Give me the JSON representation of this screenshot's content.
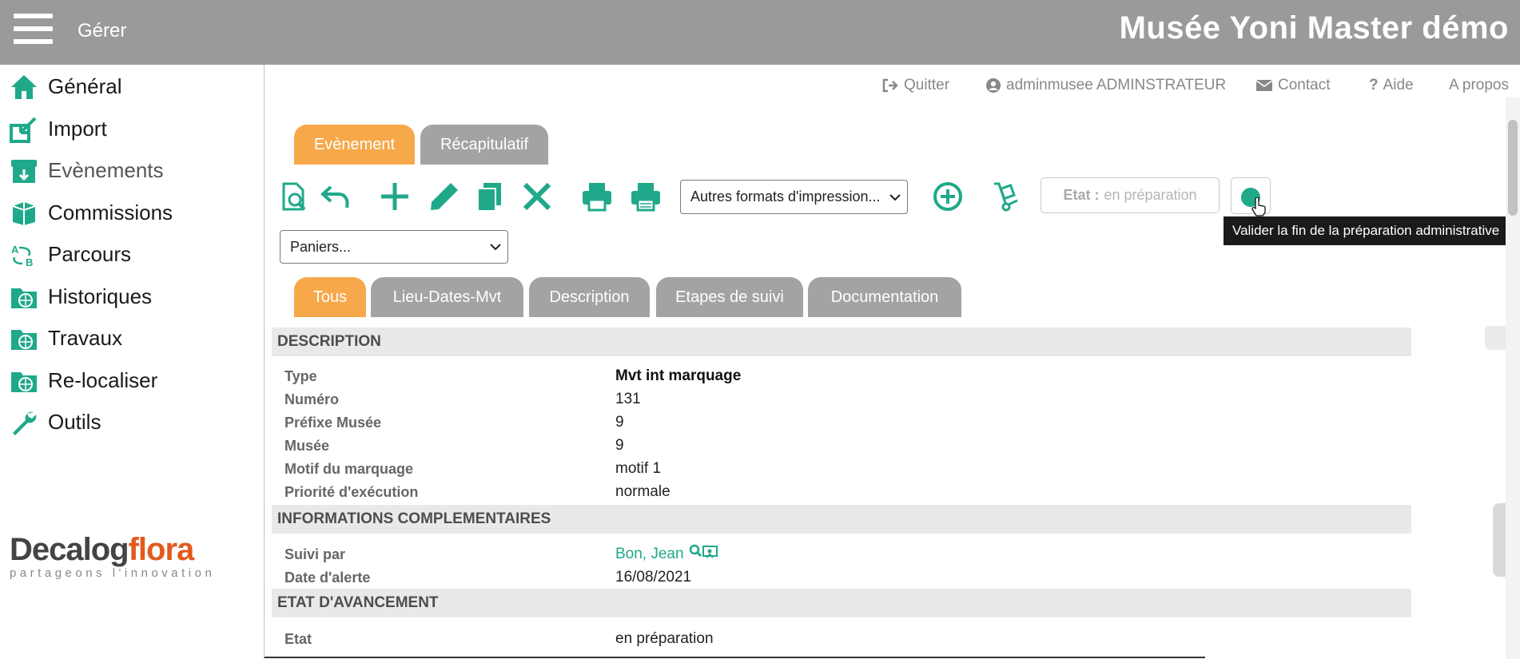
{
  "header": {
    "menu_label": "Gérer",
    "app_title": "Musée Yoni Master démo"
  },
  "sidebar": {
    "items": [
      {
        "label": "Général",
        "icon": "home-icon"
      },
      {
        "label": "Import",
        "icon": "import-icon"
      },
      {
        "label": "Evènements",
        "icon": "events-box-icon"
      },
      {
        "label": "Commissions",
        "icon": "commissions-icon"
      },
      {
        "label": "Parcours",
        "icon": "parcours-icon"
      },
      {
        "label": "Historiques",
        "icon": "folder-globe-icon"
      },
      {
        "label": "Travaux",
        "icon": "folder-globe-icon"
      },
      {
        "label": "Re-localiser",
        "icon": "folder-globe-icon"
      },
      {
        "label": "Outils",
        "icon": "wrench-icon"
      }
    ],
    "logo": {
      "part1": "Decalog",
      "part2": "flora",
      "tagline": "partageons l'innovation"
    }
  },
  "usermenu": {
    "quit": "Quitter",
    "user": "adminmusee ADMINSTRATEUR",
    "contact": "Contact",
    "help": "Aide",
    "about": "A propos"
  },
  "top_tabs": [
    "Evènement",
    "Récapitulatif"
  ],
  "toolbar": {
    "print_formats": "Autres formats d'impression...",
    "baskets": "Paniers...",
    "etat_label": "Etat :",
    "etat_value": "en préparation",
    "tooltip": "Valider la fin de la préparation administrative"
  },
  "sub_tabs": [
    "Tous",
    "Lieu-Dates-Mvt",
    "Description",
    "Etapes de suivi",
    "Documentation"
  ],
  "sections": {
    "description": {
      "title": "DESCRIPTION",
      "rows": [
        {
          "label": "Type",
          "value": "Mvt int marquage"
        },
        {
          "label": "Numéro",
          "value": "131"
        },
        {
          "label": "Préfixe Musée",
          "value": "9"
        },
        {
          "label": "Musée",
          "value": "9"
        },
        {
          "label": "Motif du marquage",
          "value": "motif 1"
        },
        {
          "label": "Priorité d'exécution",
          "value": "normale"
        }
      ]
    },
    "infos": {
      "title": "INFORMATIONS COMPLEMENTAIRES",
      "rows": [
        {
          "label": "Suivi par",
          "value": "Bon, Jean"
        },
        {
          "label": "Date d'alerte",
          "value": "16/08/2021"
        }
      ]
    },
    "etat": {
      "title": "ETAT D'AVANCEMENT",
      "rows": [
        {
          "label": "Etat",
          "value": "en préparation"
        }
      ]
    }
  },
  "colors": {
    "accent": "#1fa98a",
    "tab_active": "#f7a84a",
    "tab_inactive": "#a3a3a3",
    "header_bg": "#9a9a9a"
  }
}
